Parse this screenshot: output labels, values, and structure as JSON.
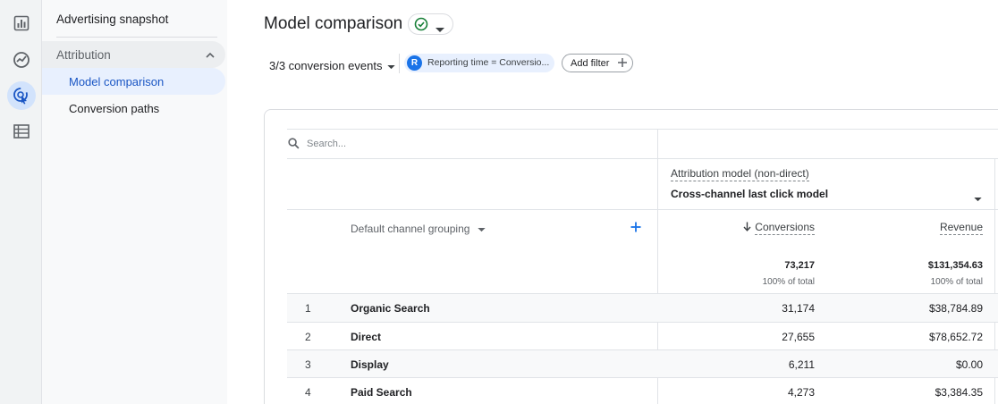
{
  "nav": {
    "rail_icons": [
      "reports-icon",
      "explore-icon",
      "advertising-icon",
      "configure-icon"
    ],
    "top_item": "Advertising snapshot",
    "section_label": "Attribution",
    "items": [
      {
        "label": "Model comparison",
        "active": true
      },
      {
        "label": "Conversion paths",
        "active": false
      }
    ]
  },
  "header": {
    "title": "Model comparison",
    "status_icon": "check-circle-icon"
  },
  "filters": {
    "events_label": "3/3 conversion events",
    "chip_initial": "R",
    "chip_text": "Reporting time = Conversio...",
    "add_filter_label": "Add filter"
  },
  "table": {
    "search_placeholder": "Search...",
    "attribution_label": "Attribution model (non-direct)",
    "attribution_model": "Cross-channel last click model",
    "dimension_label": "Default channel grouping",
    "columns": [
      {
        "label": "Conversions",
        "sorted": "desc"
      },
      {
        "label": "Revenue"
      }
    ],
    "totals": {
      "conversions": "73,217",
      "conversions_sub": "100% of total",
      "revenue": "$131,354.63",
      "revenue_sub": "100% of total"
    },
    "rows": [
      {
        "rank": "1",
        "channel": "Organic Search",
        "conversions": "31,174",
        "revenue": "$38,784.89"
      },
      {
        "rank": "2",
        "channel": "Direct",
        "conversions": "27,655",
        "revenue": "$78,652.72"
      },
      {
        "rank": "3",
        "channel": "Display",
        "conversions": "6,211",
        "revenue": "$0.00"
      },
      {
        "rank": "4",
        "channel": "Paid Search",
        "conversions": "4,273",
        "revenue": "$3,384.35"
      }
    ]
  },
  "colors": {
    "accent": "#1a73e8",
    "active_nav_text": "#1a56c4",
    "success": "#188038"
  }
}
